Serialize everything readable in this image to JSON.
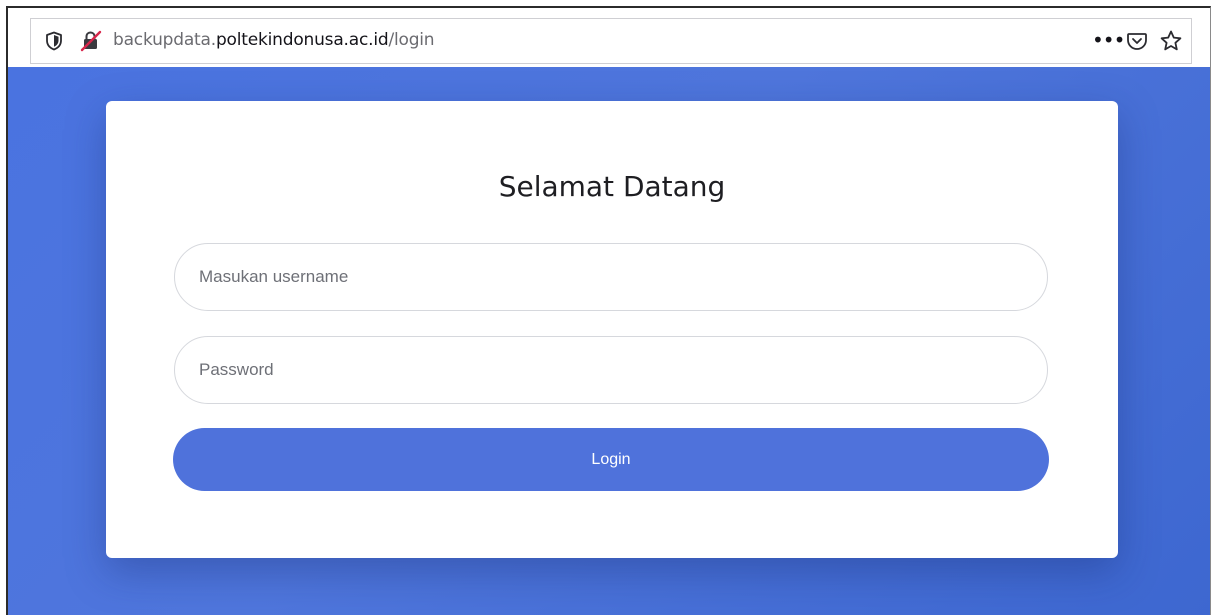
{
  "browser": {
    "url_prefix": "backupdata.",
    "url_domain": "poltekindonusa.ac.id",
    "url_path": "/login",
    "more_label": "•••"
  },
  "login": {
    "title": "Selamat Datang",
    "username_placeholder": "Masukan username",
    "password_placeholder": "Password",
    "button_label": "Login"
  },
  "colors": {
    "background": "#4a73e0",
    "button": "#4f72db",
    "card": "#ffffff"
  },
  "icons": [
    "shield-icon",
    "insecure-lock-icon",
    "more-icon",
    "pocket-icon",
    "star-icon"
  ]
}
